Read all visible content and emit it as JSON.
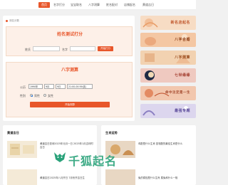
{
  "nav": {
    "items": [
      "首页",
      "名字打分",
      "宝宝取名",
      "八字测算",
      "姓名配对",
      "店铺起名",
      "黄道吉日"
    ],
    "active_index": 0
  },
  "breadcrumb": "测名分数",
  "name_test": {
    "title": "姓名测试打分",
    "surname_label": "姓氏",
    "given_label": "名字",
    "button": "开始打分"
  },
  "bazi": {
    "title": "八字测算",
    "date_label": "公历",
    "year_value": "1990年",
    "month_value": "9月",
    "day_value": "9日",
    "hour_value": "21:00-00:59(亥)",
    "gender_label": "性别",
    "male": "男性",
    "female": "女性",
    "button": "开始测算"
  },
  "banners": [
    {
      "text": "新名店起名",
      "bg": "#f7dcc4",
      "color": "#c0572d"
    },
    {
      "text": "八字合婚",
      "bg": "#f4c7a3",
      "color": "#8a3a12"
    },
    {
      "text": "八字测算",
      "bg": "#f2d2b1",
      "color": "#9a4b1c"
    },
    {
      "text": "七世缘缘",
      "bg": "#efc9c0",
      "color": "#a23b2c"
    },
    {
      "text": "命中注定是一生",
      "bg": "#f2c7ae",
      "color": "#a2452a"
    },
    {
      "text": "最强专题",
      "bg": "#dcd6ee",
      "color": "#5a4a9a"
    }
  ],
  "left_panel": {
    "title": "黄道吉日",
    "items": [
      "黄道吉日查询2025年元月一日 2025年1月吉利时吉日",
      "黄道吉日2025年八月开日 7月份开吉日生"
    ]
  },
  "right_panel": {
    "title": "生肖运势",
    "items": [
      "鸡配是什么生肖 鼠相配的最佳生肖是什么",
      "兔的原因是什么生肖 属兔和什么一相"
    ]
  },
  "watermark": "千狐起名"
}
